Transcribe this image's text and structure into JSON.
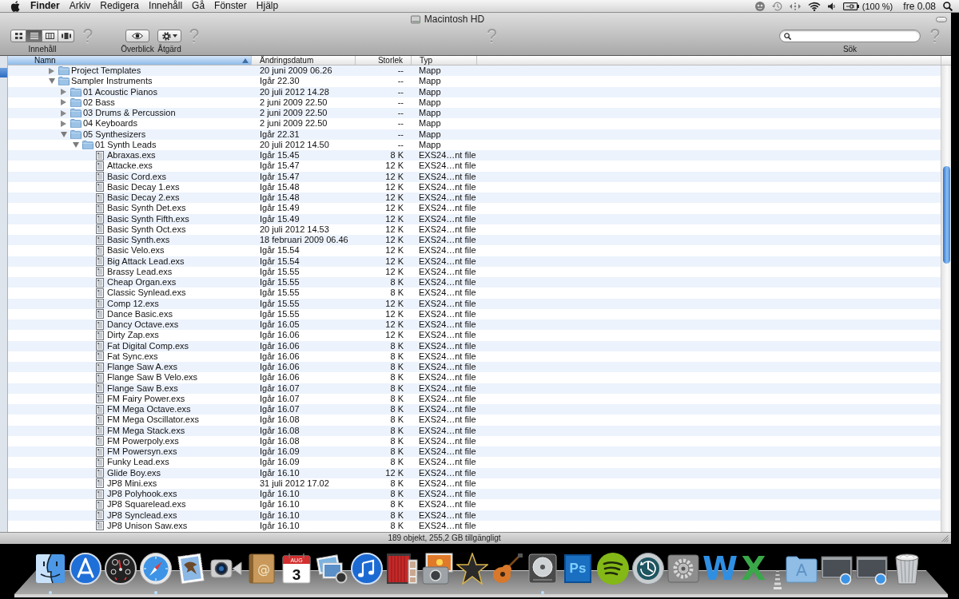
{
  "menu_bar": {
    "items": [
      {
        "label": "Finder",
        "kind": "app"
      },
      {
        "label": "Arkiv",
        "kind": "menu"
      },
      {
        "label": "Redigera",
        "kind": "menu"
      },
      {
        "label": "Innehåll",
        "kind": "menu"
      },
      {
        "label": "Gå",
        "kind": "menu"
      },
      {
        "label": "Fönster",
        "kind": "menu"
      },
      {
        "label": "Hjälp",
        "kind": "menu"
      }
    ],
    "battery": "(100 %)",
    "clock": "fre 0.08"
  },
  "window": {
    "title": "Macintosh HD"
  },
  "toolbar": {
    "left": [
      {
        "kind": "view_switcher",
        "label": "Innehåll",
        "segments": [
          {
            "kind": "icons",
            "selected": false
          },
          {
            "kind": "list",
            "selected": true
          },
          {
            "kind": "columns",
            "selected": false
          },
          {
            "kind": "coverflow",
            "selected": false
          }
        ]
      },
      {
        "kind": "missing",
        "glyph": "?"
      },
      {
        "kind": "quick_look",
        "label": "Överblick"
      },
      {
        "kind": "action",
        "label": "Åtgärd"
      },
      {
        "kind": "missing",
        "glyph": "?"
      }
    ],
    "center": [
      {
        "kind": "missing",
        "glyph": "?"
      }
    ],
    "right": [
      {
        "kind": "search",
        "label": "Sök"
      },
      {
        "kind": "missing",
        "glyph": "?"
      }
    ]
  },
  "sidebar": {
    "items": [
      {
        "selected": true
      }
    ]
  },
  "list": {
    "columns": [
      {
        "label": "Namn",
        "selected": true,
        "sorted": true
      },
      {
        "label": "Ändringsdatum",
        "selected": false,
        "sorted": false
      },
      {
        "label": "Storlek",
        "selected": false,
        "sorted": false
      },
      {
        "label": "Typ",
        "selected": false,
        "sorted": false
      }
    ],
    "rows": [
      {
        "kind": "folder",
        "name": "Project Templates",
        "date": "20 juni 2009 06.26",
        "size": "--",
        "type": "Mapp",
        "expanded": false
      },
      {
        "kind": "folder",
        "name": "Sampler Instruments",
        "date": "Igår 22.30",
        "size": "--",
        "type": "Mapp",
        "expanded": true,
        "children": [
          {
            "kind": "folder",
            "name": "01 Acoustic Pianos",
            "date": "20 juli 2012 14.28",
            "size": "--",
            "type": "Mapp",
            "expanded": false
          },
          {
            "kind": "folder",
            "name": "02 Bass",
            "date": "2 juni 2009 22.50",
            "size": "--",
            "type": "Mapp",
            "expanded": false
          },
          {
            "kind": "folder",
            "name": "03 Drums & Percussion",
            "date": "2 juni 2009 22.50",
            "size": "--",
            "type": "Mapp",
            "expanded": false
          },
          {
            "kind": "folder",
            "name": "04 Keyboards",
            "date": "2 juni 2009 22.50",
            "size": "--",
            "type": "Mapp",
            "expanded": false
          },
          {
            "kind": "folder",
            "name": "05 Synthesizers",
            "date": "Igår 22.31",
            "size": "--",
            "type": "Mapp",
            "expanded": true,
            "children": [
              {
                "kind": "folder",
                "name": "01 Synth Leads",
                "date": "20 juli 2012 14.50",
                "size": "--",
                "type": "Mapp",
                "expanded": true,
                "children": [
                  {
                    "kind": "file",
                    "name": "Abraxas.exs",
                    "date": "Igår 15.45",
                    "size": "8 K",
                    "type": "EXS24…nt file"
                  },
                  {
                    "kind": "file",
                    "name": "Attacke.exs",
                    "date": "Igår 15.47",
                    "size": "12 K",
                    "type": "EXS24…nt file"
                  },
                  {
                    "kind": "file",
                    "name": "Basic Cord.exs",
                    "date": "Igår 15.47",
                    "size": "12 K",
                    "type": "EXS24…nt file"
                  },
                  {
                    "kind": "file",
                    "name": "Basic Decay 1.exs",
                    "date": "Igår 15.48",
                    "size": "12 K",
                    "type": "EXS24…nt file"
                  },
                  {
                    "kind": "file",
                    "name": "Basic Decay 2.exs",
                    "date": "Igår 15.48",
                    "size": "12 K",
                    "type": "EXS24…nt file"
                  },
                  {
                    "kind": "file",
                    "name": "Basic Synth Det.exs",
                    "date": "Igår 15.49",
                    "size": "12 K",
                    "type": "EXS24…nt file"
                  },
                  {
                    "kind": "file",
                    "name": "Basic Synth Fifth.exs",
                    "date": "Igår 15.49",
                    "size": "12 K",
                    "type": "EXS24…nt file"
                  },
                  {
                    "kind": "file",
                    "name": "Basic Synth Oct.exs",
                    "date": "20 juli 2012 14.53",
                    "size": "12 K",
                    "type": "EXS24…nt file"
                  },
                  {
                    "kind": "file",
                    "name": "Basic Synth.exs",
                    "date": "18 februari 2009 06.46",
                    "size": "12 K",
                    "type": "EXS24…nt file"
                  },
                  {
                    "kind": "file",
                    "name": "Basic Velo.exs",
                    "date": "Igår 15.54",
                    "size": "12 K",
                    "type": "EXS24…nt file"
                  },
                  {
                    "kind": "file",
                    "name": "Big Attack Lead.exs",
                    "date": "Igår 15.54",
                    "size": "12 K",
                    "type": "EXS24…nt file"
                  },
                  {
                    "kind": "file",
                    "name": "Brassy Lead.exs",
                    "date": "Igår 15.55",
                    "size": "12 K",
                    "type": "EXS24…nt file"
                  },
                  {
                    "kind": "file",
                    "name": "Cheap Organ.exs",
                    "date": "Igår 15.55",
                    "size": "8 K",
                    "type": "EXS24…nt file"
                  },
                  {
                    "kind": "file",
                    "name": "Classic Synlead.exs",
                    "date": "Igår 15.55",
                    "size": "8 K",
                    "type": "EXS24…nt file"
                  },
                  {
                    "kind": "file",
                    "name": "Comp 12.exs",
                    "date": "Igår 15.55",
                    "size": "12 K",
                    "type": "EXS24…nt file"
                  },
                  {
                    "kind": "file",
                    "name": "Dance Basic.exs",
                    "date": "Igår 15.55",
                    "size": "12 K",
                    "type": "EXS24…nt file"
                  },
                  {
                    "kind": "file",
                    "name": "Dancy Octave.exs",
                    "date": "Igår 16.05",
                    "size": "12 K",
                    "type": "EXS24…nt file"
                  },
                  {
                    "kind": "file",
                    "name": "Dirty Zap.exs",
                    "date": "Igår 16.06",
                    "size": "12 K",
                    "type": "EXS24…nt file"
                  },
                  {
                    "kind": "file",
                    "name": "Fat Digital Comp.exs",
                    "date": "Igår 16.06",
                    "size": "8 K",
                    "type": "EXS24…nt file"
                  },
                  {
                    "kind": "file",
                    "name": "Fat Sync.exs",
                    "date": "Igår 16.06",
                    "size": "8 K",
                    "type": "EXS24…nt file"
                  },
                  {
                    "kind": "file",
                    "name": "Flange Saw A.exs",
                    "date": "Igår 16.06",
                    "size": "8 K",
                    "type": "EXS24…nt file"
                  },
                  {
                    "kind": "file",
                    "name": "Flange Saw B Velo.exs",
                    "date": "Igår 16.06",
                    "size": "8 K",
                    "type": "EXS24…nt file"
                  },
                  {
                    "kind": "file",
                    "name": "Flange Saw B.exs",
                    "date": "Igår 16.07",
                    "size": "8 K",
                    "type": "EXS24…nt file"
                  },
                  {
                    "kind": "file",
                    "name": "FM Fairy Power.exs",
                    "date": "Igår 16.07",
                    "size": "8 K",
                    "type": "EXS24…nt file"
                  },
                  {
                    "kind": "file",
                    "name": "FM Mega Octave.exs",
                    "date": "Igår 16.07",
                    "size": "8 K",
                    "type": "EXS24…nt file"
                  },
                  {
                    "kind": "file",
                    "name": "FM Mega Oscillator.exs",
                    "date": "Igår 16.08",
                    "size": "8 K",
                    "type": "EXS24…nt file"
                  },
                  {
                    "kind": "file",
                    "name": "FM Mega Stack.exs",
                    "date": "Igår 16.08",
                    "size": "8 K",
                    "type": "EXS24…nt file"
                  },
                  {
                    "kind": "file",
                    "name": "FM Powerpoly.exs",
                    "date": "Igår 16.08",
                    "size": "8 K",
                    "type": "EXS24…nt file"
                  },
                  {
                    "kind": "file",
                    "name": "FM Powersyn.exs",
                    "date": "Igår 16.09",
                    "size": "8 K",
                    "type": "EXS24…nt file"
                  },
                  {
                    "kind": "file",
                    "name": "Funky Lead.exs",
                    "date": "Igår 16.09",
                    "size": "8 K",
                    "type": "EXS24…nt file"
                  },
                  {
                    "kind": "file",
                    "name": "Glide Boy.exs",
                    "date": "Igår 16.10",
                    "size": "12 K",
                    "type": "EXS24…nt file"
                  },
                  {
                    "kind": "file",
                    "name": "JP8 Mini.exs",
                    "date": "31 juli 2012 17.02",
                    "size": "8 K",
                    "type": "EXS24…nt file"
                  },
                  {
                    "kind": "file",
                    "name": "JP8 Polyhook.exs",
                    "date": "Igår 16.10",
                    "size": "8 K",
                    "type": "EXS24…nt file"
                  },
                  {
                    "kind": "file",
                    "name": "JP8 Squarelead.exs",
                    "date": "Igår 16.10",
                    "size": "8 K",
                    "type": "EXS24…nt file"
                  },
                  {
                    "kind": "file",
                    "name": "JP8 Synclead.exs",
                    "date": "Igår 16.10",
                    "size": "8 K",
                    "type": "EXS24…nt file"
                  },
                  {
                    "kind": "file",
                    "name": "JP8 Unison Saw.exs",
                    "date": "Igår 16.10",
                    "size": "8 K",
                    "type": "EXS24…nt file"
                  }
                ]
              }
            ]
          }
        ]
      }
    ]
  },
  "status_bar": {
    "text": "189 objekt, 255,2 GB tillgängligt"
  },
  "dock": {
    "items": [
      {
        "kind": "face",
        "running": true
      },
      {
        "kind": "pencils",
        "running": false
      },
      {
        "kind": "gauge",
        "running": false
      },
      {
        "kind": "compass",
        "running": true
      },
      {
        "kind": "stamp",
        "running": false
      },
      {
        "kind": "video_camera",
        "running": false
      },
      {
        "kind": "book",
        "glyph": "@",
        "running": false
      },
      {
        "kind": "calendar",
        "month": "AUG",
        "day": "3",
        "running": false
      },
      {
        "kind": "photos",
        "running": false
      },
      {
        "kind": "music_note",
        "running": false
      },
      {
        "kind": "curtain",
        "running": false
      },
      {
        "kind": "camera",
        "running": false
      },
      {
        "kind": "star",
        "running": false
      },
      {
        "kind": "guitar",
        "running": false
      },
      {
        "kind": "disc",
        "running": true
      },
      {
        "kind": "letter_tile",
        "glyph": "Ps",
        "running": false
      },
      {
        "kind": "sound_waves",
        "running": false
      },
      {
        "kind": "clock_arrow",
        "running": false
      },
      {
        "kind": "gears",
        "running": false
      },
      {
        "kind": "letter",
        "glyph": "W",
        "color": "#2f8fe3",
        "running": false
      },
      {
        "kind": "letter",
        "glyph": "X",
        "color": "#3aa84a",
        "running": false
      },
      {
        "kind": "separator"
      },
      {
        "kind": "folder",
        "running": false
      },
      {
        "kind": "window_thumbnail",
        "running": false
      },
      {
        "kind": "window_thumbnail",
        "running": false
      },
      {
        "kind": "trash",
        "running": false
      }
    ]
  }
}
